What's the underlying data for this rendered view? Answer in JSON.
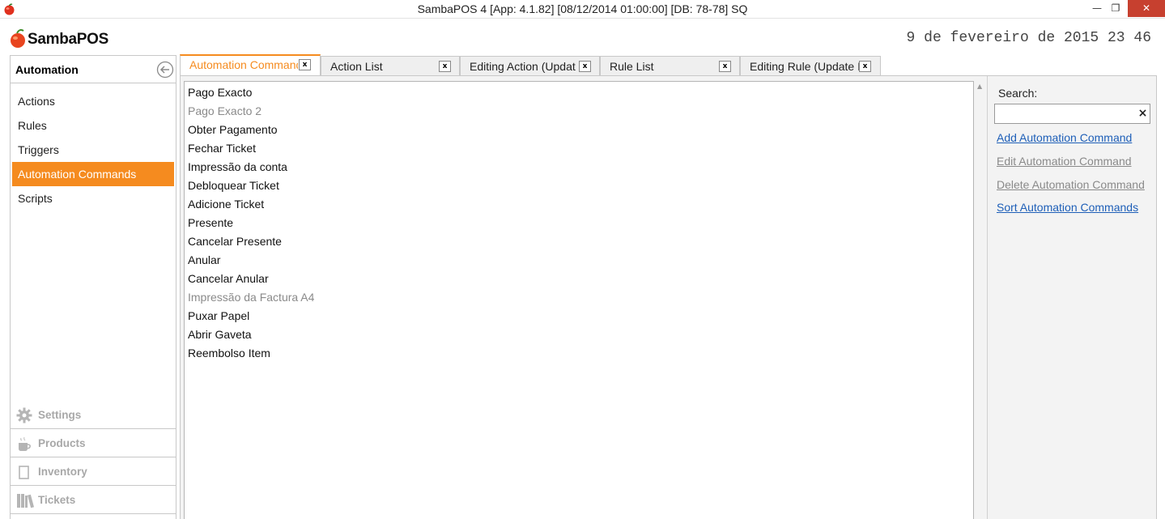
{
  "window": {
    "title": "SambaPOS 4 [App: 4.1.82] [08/12/2014 01:00:00] [DB: 78-78] SQ",
    "minimize_glyph": "—",
    "maximize_glyph": "❐",
    "close_glyph": "✕"
  },
  "header": {
    "logo_text": "SambaPOS",
    "clock": "9 de fevereiro de 2015 23 46"
  },
  "sidebar": {
    "title": "Automation",
    "items": [
      {
        "label": "Actions",
        "active": false
      },
      {
        "label": "Rules",
        "active": false
      },
      {
        "label": "Triggers",
        "active": false
      },
      {
        "label": "Automation Commands",
        "active": true
      },
      {
        "label": "Scripts",
        "active": false
      }
    ],
    "sections": [
      {
        "label": "Settings",
        "icon": "gear-icon"
      },
      {
        "label": "Products",
        "icon": "cup-icon"
      },
      {
        "label": "Inventory",
        "icon": "box-icon"
      },
      {
        "label": "Tickets",
        "icon": "books-icon"
      }
    ]
  },
  "tabs": [
    {
      "label": "Automation Command",
      "active": true,
      "close": "x"
    },
    {
      "label": "Action List",
      "active": false,
      "close": "x"
    },
    {
      "label": "Editing Action (Updat",
      "active": false,
      "close": "x"
    },
    {
      "label": "Rule List",
      "active": false,
      "close": "x"
    },
    {
      "label": "Editing Rule (Update I",
      "active": false,
      "close": "x"
    }
  ],
  "list": {
    "items": [
      {
        "label": "Pago Exacto",
        "disabled": false
      },
      {
        "label": "Pago Exacto 2",
        "disabled": true
      },
      {
        "label": "Obter Pagamento",
        "disabled": false
      },
      {
        "label": "Fechar Ticket",
        "disabled": false
      },
      {
        "label": "Impressão da conta",
        "disabled": false
      },
      {
        "label": "Debloquear Ticket",
        "disabled": false
      },
      {
        "label": "Adicione Ticket",
        "disabled": false
      },
      {
        "label": "Presente",
        "disabled": false
      },
      {
        "label": "Cancelar Presente",
        "disabled": false
      },
      {
        "label": "Anular",
        "disabled": false
      },
      {
        "label": "Cancelar Anular",
        "disabled": false
      },
      {
        "label": "Impressão da Factura A4",
        "disabled": true
      },
      {
        "label": "Puxar Papel",
        "disabled": false
      },
      {
        "label": "Abrir Gaveta",
        "disabled": false
      },
      {
        "label": "Reembolso Item",
        "disabled": false
      }
    ]
  },
  "right_panel": {
    "search_label": "Search:",
    "search_value": "",
    "clear_glyph": "×",
    "commands": [
      {
        "label": "Add Automation Command",
        "enabled": true
      },
      {
        "label": "Edit Automation Command",
        "enabled": false
      },
      {
        "label": "Delete Automation Command",
        "enabled": false
      },
      {
        "label": "Sort Automation Commands",
        "enabled": true
      }
    ]
  },
  "colors": {
    "accent": "#f58b1f",
    "link": "#1e5fb8",
    "disabled_text": "#8a8a8a",
    "close_button": "#c7402f"
  }
}
